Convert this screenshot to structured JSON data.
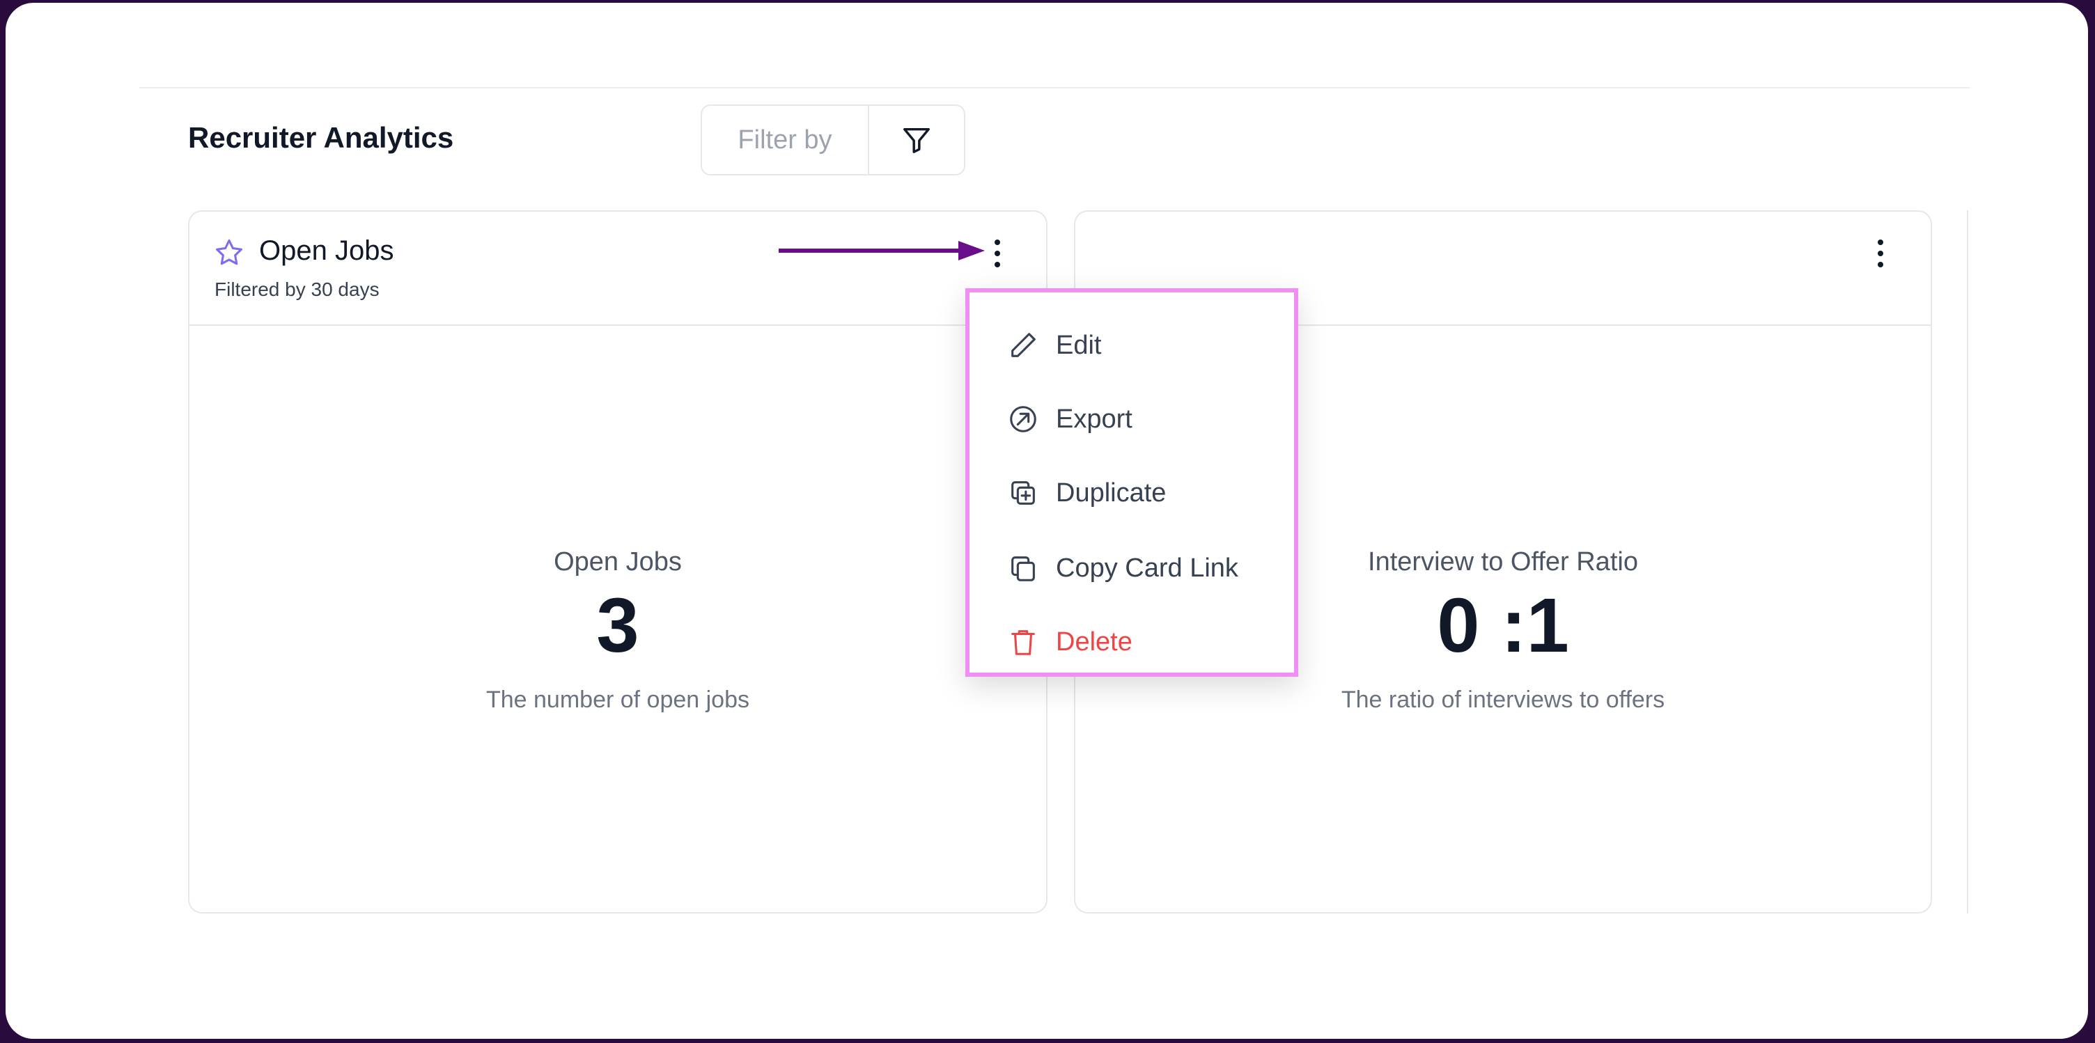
{
  "page": {
    "title": "Recruiter Analytics"
  },
  "filter": {
    "label": "Filter by",
    "icon": "filter-icon"
  },
  "cards": [
    {
      "title": "Open Jobs",
      "subtitle": "Filtered by 30 days",
      "metric_label": "Open Jobs",
      "metric_value": "3",
      "metric_desc": "The number of open jobs",
      "favorite_icon": "star-icon"
    },
    {
      "metric_label": "Interview to Offer Ratio",
      "metric_value": "0 :1",
      "metric_desc": "The ratio of interviews to offers"
    }
  ],
  "menu": {
    "items": [
      {
        "label": "Edit",
        "icon": "pencil-icon"
      },
      {
        "label": "Export",
        "icon": "export-icon"
      },
      {
        "label": "Duplicate",
        "icon": "duplicate-icon"
      },
      {
        "label": "Copy Card Link",
        "icon": "copy-icon"
      },
      {
        "label": "Delete",
        "icon": "trash-icon"
      }
    ]
  },
  "colors": {
    "accent": "#7c3aed",
    "arrow": "#6a0d8a",
    "menu_highlight": "#f08ff3",
    "danger": "#ef4444"
  }
}
